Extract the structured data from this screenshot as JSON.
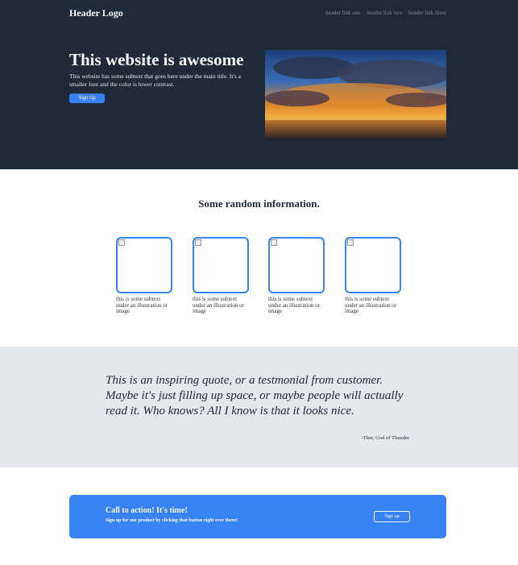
{
  "colors": {
    "header_bg": "#1f2937",
    "accent": "#3882f6",
    "quote_bg": "#e5e7eb",
    "light_text": "#f9faf8",
    "nav_text": "#7b8797"
  },
  "header": {
    "logo": "Header Logo",
    "nav_links": [
      "header link one",
      "header link two",
      "header link three"
    ]
  },
  "hero": {
    "title": "This website is awesome",
    "subtext": "This website has some subtext that goes here under the main title. It's a smaller font and the color is lower contrast.",
    "button_label": "Sign Up"
  },
  "info": {
    "title": "Some random information.",
    "cards": [
      {
        "text": "this is some subtext under an illustration or image"
      },
      {
        "text": "this is some subtext under an illustration or image"
      },
      {
        "text": "this is some subtext under an illustration or image"
      },
      {
        "text": "this is some subtext under an illustration or image"
      }
    ]
  },
  "quote": {
    "text": "This is an inspiring quote, or a testmonial from customer. Maybe it's just filling up space, or maybe people will actually read it. Who knows? All I know is that it looks nice.",
    "author": "-Thor, God of Thunder"
  },
  "cta": {
    "title": "Call to action! It's time!",
    "subtext": "Sign up for our product by clicking that button right over there!",
    "button_label": "Sign up"
  }
}
